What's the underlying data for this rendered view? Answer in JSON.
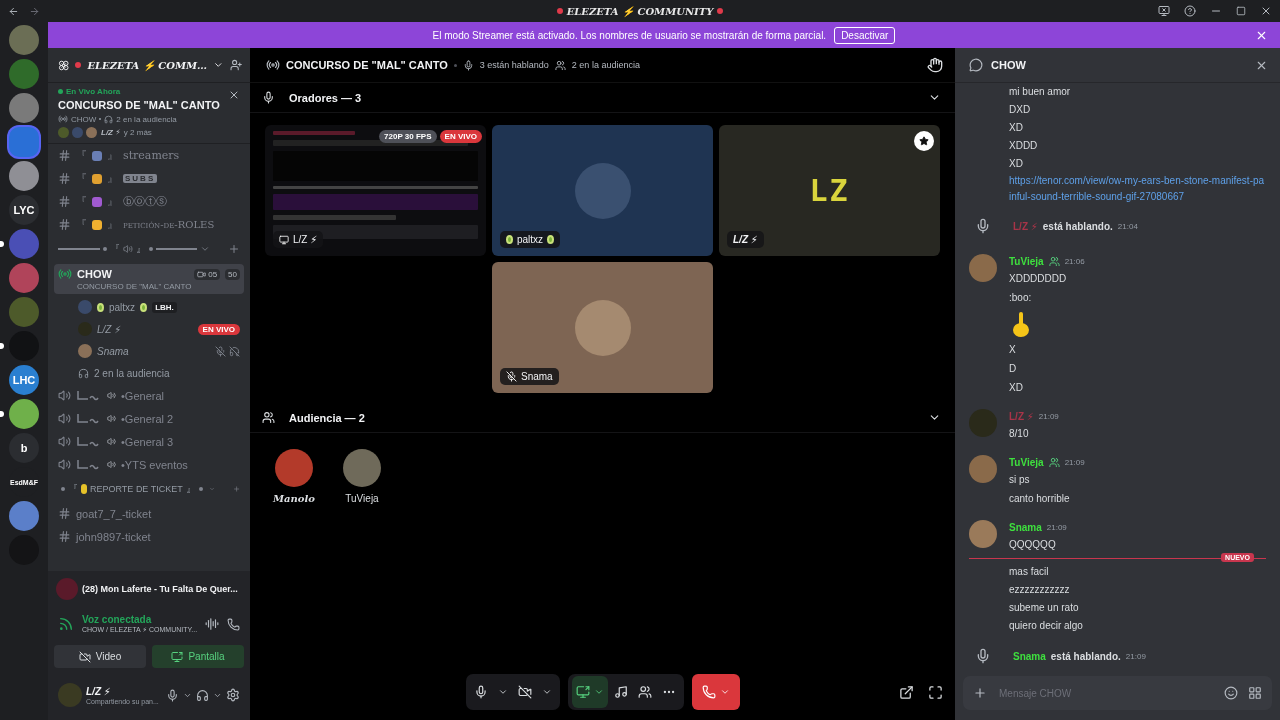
{
  "window": {
    "title": "ELEZETA ⚡ COMMUNITY"
  },
  "banner": {
    "text": "El modo Streamer está activado. Los nombres de usuario se mostrarán de forma parcial.",
    "button": "Desactivar"
  },
  "servers": [
    {
      "kind": "image",
      "color": "#6b6e55",
      "selected": false,
      "unread": false
    },
    {
      "kind": "image",
      "color": "#2f6b2a",
      "selected": false,
      "unread": false
    },
    {
      "kind": "image",
      "color": "#7a7a7a",
      "selected": false,
      "unread": false
    },
    {
      "kind": "image",
      "color": "#2a6fd6",
      "selected": true,
      "unread": false
    },
    {
      "kind": "image",
      "color": "#8f8f95",
      "selected": false,
      "unread": false
    },
    {
      "kind": "text",
      "label": "LYC",
      "color": "#2b2d31",
      "selected": false,
      "unread": false
    },
    {
      "kind": "image",
      "color": "#4a4fb5",
      "selected": false,
      "unread": true
    },
    {
      "kind": "image",
      "color": "#b0445a",
      "selected": false,
      "unread": false
    },
    {
      "kind": "image",
      "color": "#4d5a2a",
      "selected": false,
      "unread": false
    },
    {
      "kind": "image",
      "color": "#111214",
      "selected": false,
      "unread": true
    },
    {
      "kind": "text",
      "label": "LHC",
      "color": "#2a7fd0",
      "selected": false,
      "unread": false
    },
    {
      "kind": "image",
      "color": "#6fb04a",
      "selected": false,
      "unread": true
    },
    {
      "kind": "text",
      "label": "b",
      "color": "#2b2d31",
      "selected": false,
      "unread": false
    },
    {
      "kind": "text",
      "label": "EsdM&F",
      "color": "#1e1f22",
      "selected": false,
      "unread": false
    },
    {
      "kind": "image",
      "color": "#5b7fc9",
      "selected": false,
      "unread": false
    },
    {
      "kind": "image",
      "color": "#141416",
      "selected": false,
      "unread": false
    }
  ],
  "server_header": {
    "name": "ELEZETA ⚡ COMM…"
  },
  "live_card": {
    "status": "En Vivo Ahora",
    "title": "CONCURSO DE \"MAL\" CANTO",
    "channel": "CHOW",
    "audience": "2 en la audiencia",
    "host": "L/Z ⚡",
    "more": "y 2 más"
  },
  "channels": [
    {
      "kind": "text",
      "prefix": "『",
      "suffix": "』",
      "emoji": {
        "color": "#6a7fb5"
      },
      "title": {
        "text": "streamers",
        "kind": "serif"
      }
    },
    {
      "kind": "text",
      "prefix": "『",
      "suffix": "』",
      "emoji": {
        "color": "#e0a030"
      },
      "title": {
        "text": "SUBS",
        "kind": "boxed"
      }
    },
    {
      "kind": "text",
      "prefix": "『",
      "suffix": "』",
      "emoji": {
        "color": "#a05ad0"
      },
      "title": {
        "text": "ⓑⓞⓣⓢ",
        "kind": "plain"
      }
    },
    {
      "kind": "text",
      "prefix": "『",
      "suffix": "』",
      "emoji": {
        "color": "#f0b030"
      },
      "title": {
        "text": "petición-de-ROLES",
        "kind": "smallcaps"
      }
    },
    {
      "kind": "category",
      "prefix": "『",
      "suffix": "』"
    },
    {
      "kind": "stage",
      "name": "CHOW",
      "topic": "CONCURSO DE \"MAL\" CANTO",
      "video_count": "05",
      "limit": "50",
      "selected": true,
      "audience": "2 en la audiencia",
      "members": [
        {
          "name": "paltxz",
          "color": "#3a4a6a",
          "decorated": true,
          "tag": "LBH.",
          "live": false,
          "muted": false
        },
        {
          "name": "L/Z ⚡",
          "color": "#2a2a1a",
          "decorated": false,
          "live": true,
          "badge": "EN VIVO",
          "muted": false
        },
        {
          "name": "Snama",
          "color": "#8a7058",
          "decorated": false,
          "live": false,
          "muted": true
        }
      ]
    },
    {
      "kind": "voice",
      "name": "•General"
    },
    {
      "kind": "voice",
      "name": "•General 2"
    },
    {
      "kind": "voice",
      "name": "•General 3"
    },
    {
      "kind": "voice",
      "name": "•YTS eventos"
    },
    {
      "kind": "category",
      "prefix": "『",
      "label": "REPORTE DE TICKET",
      "suffix": "』"
    },
    {
      "kind": "ticket",
      "name": "goat7_7_-ticket"
    },
    {
      "kind": "ticket",
      "name": "john9897-ticket"
    }
  ],
  "activity": {
    "title": "(28) Mon Laferte - Tu Falta De Quer..."
  },
  "voice": {
    "status": "Voz conectada",
    "location": "CHOW / ELEZETA ⚡ COMMUNITY...",
    "video": "Video",
    "screen": "Pantalla",
    "screen_on": true
  },
  "user": {
    "name": "L/Z ⚡",
    "status": "Compartiendo su pan..."
  },
  "stage": {
    "title": "CONCURSO DE \"MAL\" CANTO",
    "speaking": "3 están hablando",
    "audience": "2 en la audiencia",
    "speakers_label": "Oradores — 3",
    "audience_label": "Audiencia — 2",
    "tiles": [
      {
        "kind": "screen",
        "name": "L/Z ⚡",
        "quality": "720P 30 FPS",
        "live": "EN VIVO"
      },
      {
        "kind": "avatar",
        "name": "paltxz",
        "color": "#1f3452",
        "decorated": true,
        "muted": false
      },
      {
        "kind": "logo",
        "name": "L/Z ⚡",
        "logo": "LZ",
        "color": "#282822",
        "moderator": true
      },
      {
        "kind": "avatar",
        "name": "Snama",
        "color": "#7e6553",
        "decorated": false,
        "muted": true
      }
    ],
    "audience_members": [
      {
        "name": "Manolo",
        "kind": "script",
        "color": "#b33a2a"
      },
      {
        "name": "TuVieja",
        "kind": "plain",
        "color": "#6f6a5a"
      }
    ]
  },
  "controls": {
    "camera_off": true,
    "screen_sharing": true
  },
  "chat": {
    "title": "CHOW",
    "placeholder": "Mensaje CHOW",
    "messages": [
      {
        "kind": "text",
        "text": "mi buen amor"
      },
      {
        "kind": "text",
        "text": "DXD"
      },
      {
        "kind": "text",
        "text": "XD"
      },
      {
        "kind": "text",
        "text": "XDDD"
      },
      {
        "kind": "text",
        "text": "XD"
      },
      {
        "kind": "link",
        "text": "https://tenor.com/view/ow-my-ears-ben-stone-manifest-painful-sound-terrible-sound-gif-27080667"
      },
      {
        "kind": "system",
        "author": "L/Z ⚡",
        "color": "#a83448",
        "text": "está hablando.",
        "time": "21:04"
      },
      {
        "kind": "message",
        "author": "TuVieja",
        "color": "#3ee03e",
        "badge": true,
        "avatar": {
          "color": "#8a6a4a"
        },
        "time": "21:06",
        "lines": [
          {
            "kind": "text",
            "text": "XDDDDDDD"
          },
          {
            "kind": "text",
            "text": ":boo:"
          },
          {
            "kind": "emoji"
          },
          {
            "kind": "text",
            "text": "X"
          },
          {
            "kind": "text",
            "text": "D"
          },
          {
            "kind": "text",
            "text": "XD"
          }
        ]
      },
      {
        "kind": "message",
        "author": "L/Z ⚡",
        "color": "#a83448",
        "badge": false,
        "avatar": {
          "color": "#2a2a1a"
        },
        "time": "21:09",
        "lines": [
          {
            "kind": "text",
            "text": "8/10"
          }
        ]
      },
      {
        "kind": "message",
        "author": "TuVieja",
        "color": "#3ee03e",
        "badge": true,
        "avatar": {
          "color": "#8a6a4a"
        },
        "time": "21:09",
        "lines": [
          {
            "kind": "text",
            "text": "si ps"
          },
          {
            "kind": "text",
            "text": "canto horrible"
          }
        ]
      },
      {
        "kind": "message",
        "author": "Snama",
        "color": "#3ee03e",
        "badge": false,
        "avatar": {
          "color": "#9a7a5a"
        },
        "time": "21:09",
        "lines": [
          {
            "kind": "text",
            "text": "QQQQQQ"
          }
        ]
      },
      {
        "kind": "divider",
        "label": "NUEVO"
      },
      {
        "kind": "text",
        "text": "mas facil"
      },
      {
        "kind": "text",
        "text": "ezzzzzzzzzzz"
      },
      {
        "kind": "text",
        "text": "subeme un rato"
      },
      {
        "kind": "text",
        "text": "quiero decir algo"
      },
      {
        "kind": "system",
        "author": "Snama",
        "color": "#3ee03e",
        "text": "está hablando.",
        "time": "21:09"
      }
    ]
  }
}
